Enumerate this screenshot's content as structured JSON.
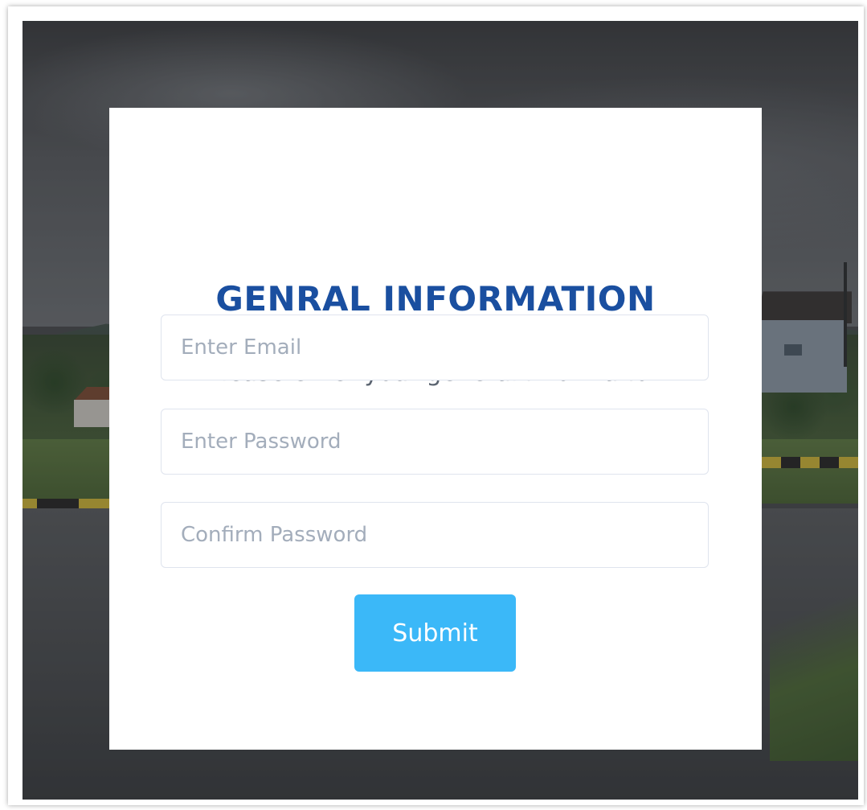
{
  "form": {
    "title": "GENRAL INFORMATION",
    "subtitle": "Please enter your general information",
    "email": {
      "placeholder": "Enter Email",
      "value": ""
    },
    "password": {
      "placeholder": "Enter Password",
      "value": ""
    },
    "confirm_password": {
      "placeholder": "Confirm Password",
      "value": ""
    },
    "submit_label": "Submit"
  },
  "colors": {
    "title": "#1a4fa0",
    "subtitle": "#5b6470",
    "button": "#3bb8f8",
    "button_text": "#ffffff",
    "field_border": "#dfe4ee",
    "placeholder": "#a3adbb"
  }
}
